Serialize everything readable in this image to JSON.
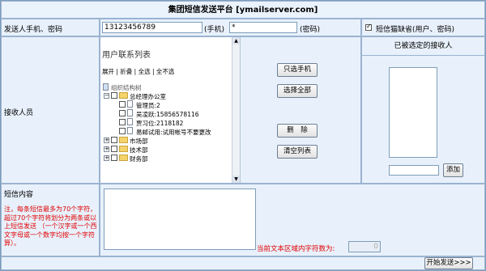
{
  "page_title": "集团短信发送平台 [ymailserver.com]",
  "sender": {
    "label": "发送人手机、密码",
    "phone_value": "13123456789",
    "phone_unit": "(手机)",
    "password_value": "*",
    "password_unit": "(密码)",
    "default_checkbox_label": "短信猫缺省(用户、密码)",
    "default_checked": true
  },
  "receivers": {
    "label": "接收人员",
    "contacts_title": "用户联系列表",
    "actions": [
      "展开",
      "折叠",
      "全选",
      "全不选"
    ],
    "selected_title": "已被选定的接收人",
    "tree": {
      "root": "组织结构树",
      "office": "总经理办公室",
      "people": [
        "管理员:2",
        "吴凌跃:15856578116",
        "贾习位:2118182",
        "易邮试用:试用帐号不要更改"
      ],
      "departments": [
        "市场部",
        "技术部",
        "财务部"
      ]
    },
    "buttons": {
      "select_phone": "只选手机",
      "select_all": "选择全部",
      "delete": "删　除",
      "clear": "清空列表",
      "add": "添加"
    }
  },
  "content": {
    "label": "短信内容",
    "note": "注，每条短信最多为70个字符，超过70个字符将划分为两条或以上短信发送 （一个汉字或一个西文字母或一个数字均按一个字符算）。",
    "count_label": "当前文本区域内字符数为:",
    "count_value": "0"
  },
  "send_button": "开始发送>>>"
}
